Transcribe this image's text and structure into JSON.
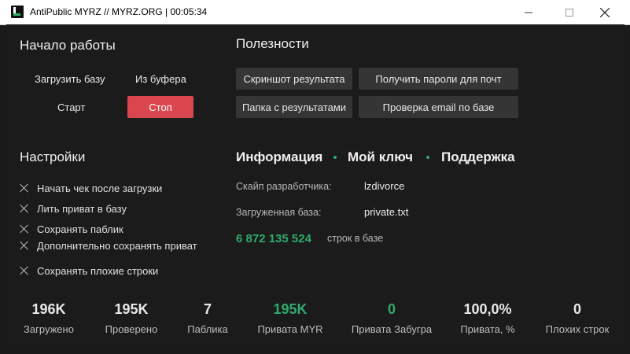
{
  "window": {
    "title": "AntiPublic MYRZ // MYRZ.ORG | 00:05:34",
    "minimize_icon": "minimize-icon",
    "maximize_icon": "maximize-icon",
    "close_icon": "close-icon"
  },
  "start": {
    "heading": "Начало работы",
    "load_base": "Загрузить базу",
    "from_clipboard": "Из буфера",
    "start": "Старт",
    "stop": "Стоп"
  },
  "utilities": {
    "heading": "Полезности",
    "buttons": [
      "Скриншот результата",
      "Получить пароли для почт",
      "Папка с результатами",
      "Проверка email по базе"
    ]
  },
  "settings": {
    "heading": "Настройки",
    "options": [
      "Начать чек после загрузки",
      "Лить приват в базу",
      "Сохранять паблик",
      "Дополнительно сохранять приват",
      "Сохранять плохие строки"
    ]
  },
  "info": {
    "tab_info": "Информация",
    "tab_key": "Мой ключ",
    "tab_support": "Поддержка",
    "dev_skype_label": "Скайп разработчика:",
    "dev_skype_value": "lzdivorce",
    "loaded_base_label": "Загруженная база:",
    "loaded_base_value": "private.txt",
    "lines_count": "6 872 135 524",
    "lines_label": "строк в базе"
  },
  "stats": [
    {
      "value": "196K",
      "label": "Загружено"
    },
    {
      "value": "195K",
      "label": "Проверено"
    },
    {
      "value": "7",
      "label": "Паблика"
    },
    {
      "value": "195K",
      "label": "Привата MYR"
    },
    {
      "value": "0",
      "label": "Привата Забугра"
    },
    {
      "value": "100,0%",
      "label": "Привата, %"
    },
    {
      "value": "0",
      "label": "Плохих строк"
    }
  ],
  "colors": {
    "accent_green": "#2faa6c",
    "stop_red": "#d9464e",
    "background": "#1b1b1b",
    "button_bg": "#353535"
  }
}
